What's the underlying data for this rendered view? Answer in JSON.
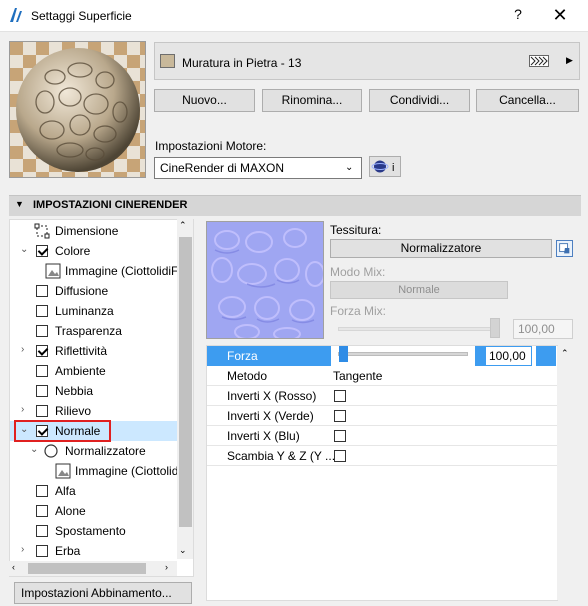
{
  "window": {
    "title": "Settaggi Superficie",
    "help": "?",
    "close": "✕"
  },
  "material": {
    "name": "Muratura in Pietra - 13",
    "swatch_color": "#c8b89a",
    "pattern_caret": "▶"
  },
  "actions": {
    "new": "Nuovo...",
    "rename": "Rinomina...",
    "share": "Condividi...",
    "delete": "Cancella..."
  },
  "engine": {
    "label": "Impostazioni Motore:",
    "value": "CineRender di MAXON",
    "info": "i"
  },
  "section": {
    "title": "IMPOSTAZIONI CINERENDER"
  },
  "tree": {
    "items": [
      {
        "label": "Dimensione"
      },
      {
        "label": "Colore"
      },
      {
        "label": "Immagine (CiottolidiFi"
      },
      {
        "label": "Diffusione"
      },
      {
        "label": "Luminanza"
      },
      {
        "label": "Trasparenza"
      },
      {
        "label": "Riflettività"
      },
      {
        "label": "Ambiente"
      },
      {
        "label": "Nebbia"
      },
      {
        "label": "Rilievo"
      },
      {
        "label": "Normale"
      },
      {
        "label": "Normalizzatore"
      },
      {
        "label": "Immagine (Ciottolidi"
      },
      {
        "label": "Alfa"
      },
      {
        "label": "Alone"
      },
      {
        "label": "Spostamento"
      },
      {
        "label": "Erba"
      }
    ],
    "matching_button": "Impostazioni Abbinamento..."
  },
  "texture": {
    "label": "Tessitura:",
    "button": "Normalizzatore",
    "mix_mode_label": "Modo Mix:",
    "mix_mode_value": "Normale",
    "mix_strength_label": "Forza Mix:",
    "mix_strength_value": "100,00"
  },
  "properties": {
    "strength_label": "Forza",
    "strength_value": "100,00",
    "method_label": "Metodo",
    "method_value": "Tangente",
    "invert_x_red": "Inverti X (Rosso)",
    "invert_x_green": "Inverti X (Verde)",
    "invert_x_blue": "Inverti X (Blu)",
    "swap_yz": "Scambia Y & Z (Y ..."
  },
  "colors": {
    "accent": "#3d9cf0",
    "selection": "#cce8ff",
    "highlight_border": "#e02020"
  }
}
